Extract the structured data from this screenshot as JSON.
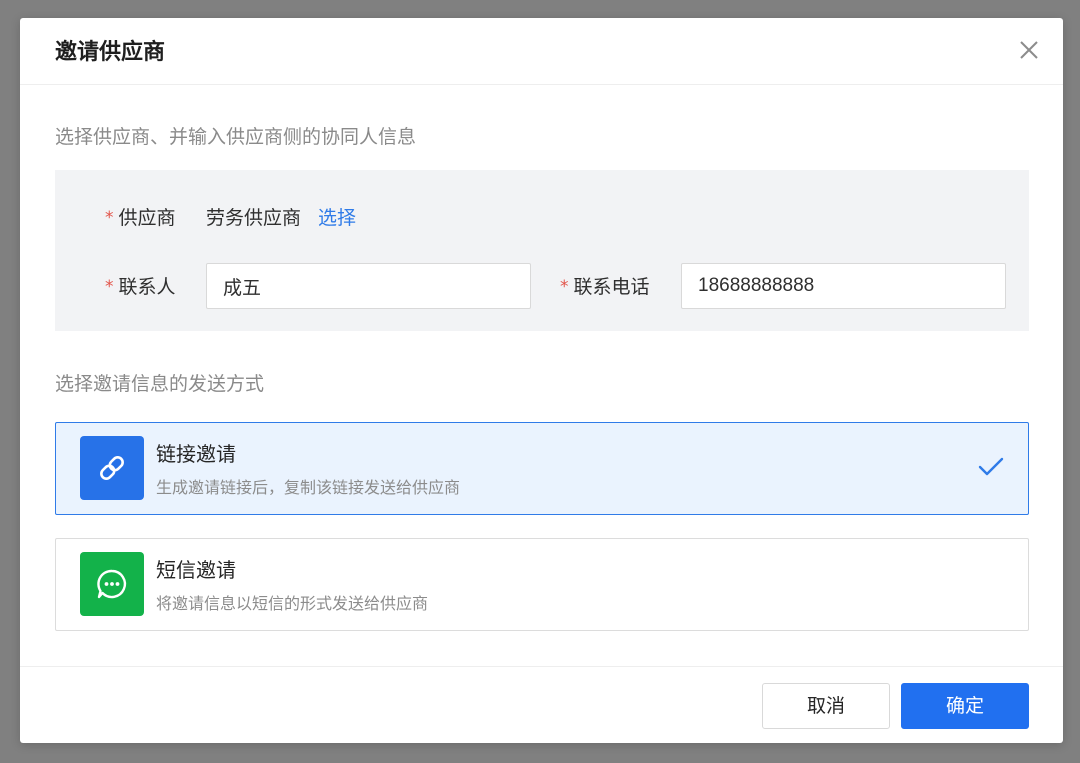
{
  "dialog": {
    "title": "邀请供应商"
  },
  "supplier_section": {
    "hint": "选择供应商、并输入供应商侧的协同人信息",
    "supplier": {
      "required_mark": "*",
      "label": "供应商",
      "value": "劳务供应商",
      "select_link": "选择"
    },
    "contact": {
      "required_mark": "*",
      "label": "联系人",
      "value": "成五"
    },
    "phone": {
      "required_mark": "*",
      "label": "联系电话",
      "value": "18688888888"
    }
  },
  "send_section": {
    "hint": "选择邀请信息的发送方式",
    "options": [
      {
        "title": "链接邀请",
        "description": "生成邀请链接后，复制该链接发送给供应商",
        "icon": "link-icon",
        "icon_color": "#2772e8",
        "selected": true
      },
      {
        "title": "短信邀请",
        "description": "将邀请信息以短信的形式发送给供应商",
        "icon": "chat-bubble-icon",
        "icon_color": "#13b24a",
        "selected": false
      }
    ]
  },
  "footer": {
    "cancel_label": "取消",
    "confirm_label": "确定"
  },
  "colors": {
    "primary": "#2170f0",
    "link": "#2f7be8",
    "required": "#e2544a",
    "selected_bg": "#eaf3fe",
    "success": "#13b24a"
  }
}
